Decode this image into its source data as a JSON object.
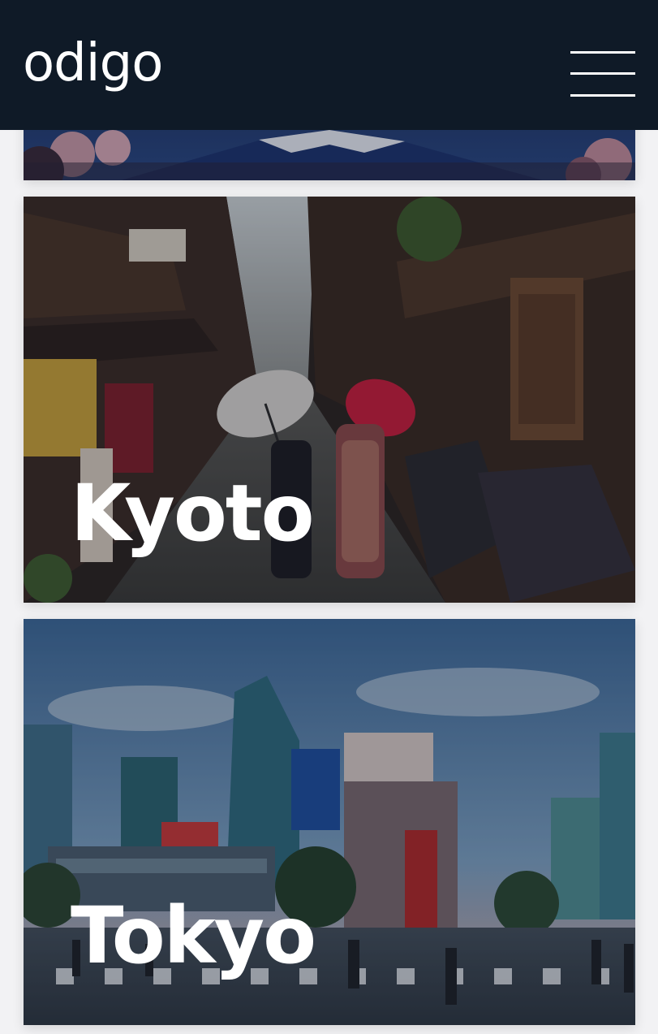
{
  "header": {
    "logo_text": "odigo",
    "menu_icon": "hamburger-menu-icon"
  },
  "destinations": [
    {
      "title": "",
      "image": "mount-fuji-with-cherry-blossoms-photo"
    },
    {
      "title": "Kyoto",
      "image": "kyoto-street-with-umbrellas-photo"
    },
    {
      "title": "Tokyo",
      "image": "tokyo-shibuya-crossing-photo"
    }
  ],
  "colors": {
    "header_bg": "#0f1a27",
    "page_bg": "#f2f2f4",
    "title_text": "#ffffff"
  }
}
